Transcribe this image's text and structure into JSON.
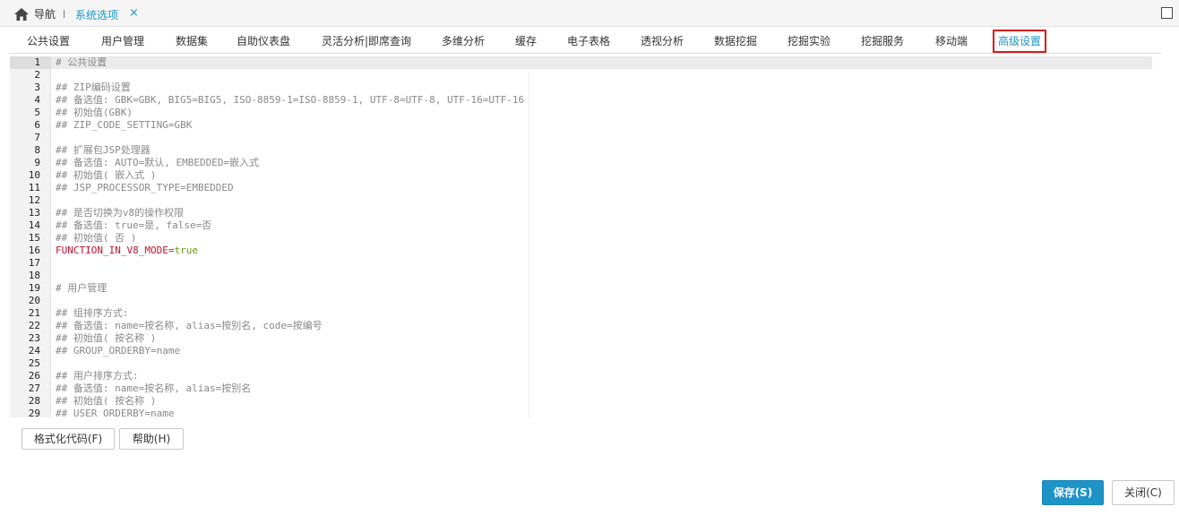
{
  "topbar": {
    "home_label": "导航",
    "active_tab": "系统选项",
    "close_glyph": "×",
    "icons": [
      "home-icon",
      "close-icon",
      "maximize-icon"
    ]
  },
  "tabs": [
    {
      "label": "公共设置"
    },
    {
      "label": "用户管理"
    },
    {
      "label": "数据集"
    },
    {
      "label": "自助仪表盘"
    },
    {
      "label": "灵活分析|即席查询"
    },
    {
      "label": "多维分析"
    },
    {
      "label": "缓存"
    },
    {
      "label": "电子表格"
    },
    {
      "label": "透视分析"
    },
    {
      "label": "数据挖掘"
    },
    {
      "label": "挖掘实验"
    },
    {
      "label": "挖掘服务"
    },
    {
      "label": "移动端"
    },
    {
      "label": "高级设置",
      "selected": true
    }
  ],
  "editor": {
    "lines": [
      {
        "n": "1",
        "text": "# 公共设置"
      },
      {
        "n": "2",
        "text": ""
      },
      {
        "n": "3",
        "text": "## ZIP编码设置"
      },
      {
        "n": "4",
        "text": "## 备选值: GBK=GBK, BIG5=BIG5, ISO-8859-1=ISO-8859-1, UTF-8=UTF-8, UTF-16=UTF-16"
      },
      {
        "n": "5",
        "text": "## 初始值(GBK)"
      },
      {
        "n": "6",
        "text": "## ZIP_CODE_SETTING=GBK"
      },
      {
        "n": "7",
        "text": ""
      },
      {
        "n": "8",
        "text": "## 扩展包JSP处理器"
      },
      {
        "n": "9",
        "text": "## 备选值: AUTO=默认, EMBEDDED=嵌入式"
      },
      {
        "n": "10",
        "text": "## 初始值( 嵌入式 )"
      },
      {
        "n": "11",
        "text": "## JSP_PROCESSOR_TYPE=EMBEDDED"
      },
      {
        "n": "12",
        "text": ""
      },
      {
        "n": "13",
        "text": "## 是否切换为v8的操作权限"
      },
      {
        "n": "14",
        "text": "## 备选值: true=是, false=否"
      },
      {
        "n": "15",
        "text": "## 初始值( 否 )"
      },
      {
        "n": "16",
        "key": "FUNCTION_IN_V8_MODE",
        "op": "=",
        "value": "true"
      },
      {
        "n": "17",
        "text": ""
      },
      {
        "n": "18",
        "text": ""
      },
      {
        "n": "19",
        "text": "# 用户管理"
      },
      {
        "n": "20",
        "text": ""
      },
      {
        "n": "21",
        "text": "## 组排序方式:"
      },
      {
        "n": "22",
        "text": "## 备选值: name=按名称, alias=按别名, code=按编号"
      },
      {
        "n": "23",
        "text": "## 初始值( 按名称 )"
      },
      {
        "n": "24",
        "text": "## GROUP_ORDERBY=name"
      },
      {
        "n": "25",
        "text": ""
      },
      {
        "n": "26",
        "text": "## 用户排序方式:"
      },
      {
        "n": "27",
        "text": "## 备选值: name=按名称, alias=按别名"
      },
      {
        "n": "28",
        "text": "## 初始值( 按名称 )"
      },
      {
        "n": "29",
        "text": "## USER_ORDERBY=name"
      }
    ]
  },
  "buttons": {
    "format": "格式化代码(F)",
    "help": "帮助(H)",
    "save": "保存(S)",
    "close": "关闭(C)"
  }
}
